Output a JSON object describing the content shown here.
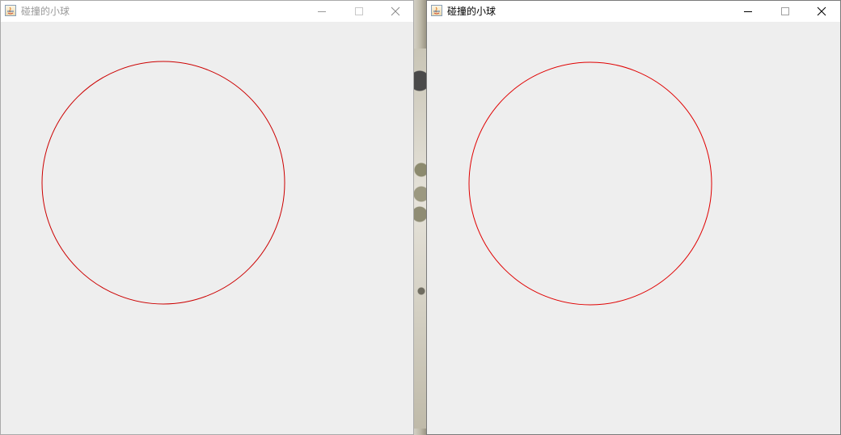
{
  "windows": [
    {
      "title": "碰撞的小球",
      "active": false,
      "ball_color": "#cc0000"
    },
    {
      "title": "碰撞的小球",
      "active": true,
      "ball_color": "#e00000"
    }
  ],
  "icons": {
    "app": "java-icon",
    "minimize": "minimize-icon",
    "maximize": "maximize-icon",
    "close": "close-icon"
  },
  "colors": {
    "client_bg": "#eeeeee",
    "titlebar_bg": "#ffffff",
    "inactive_title": "#9a9a9a",
    "active_title": "#000000"
  }
}
